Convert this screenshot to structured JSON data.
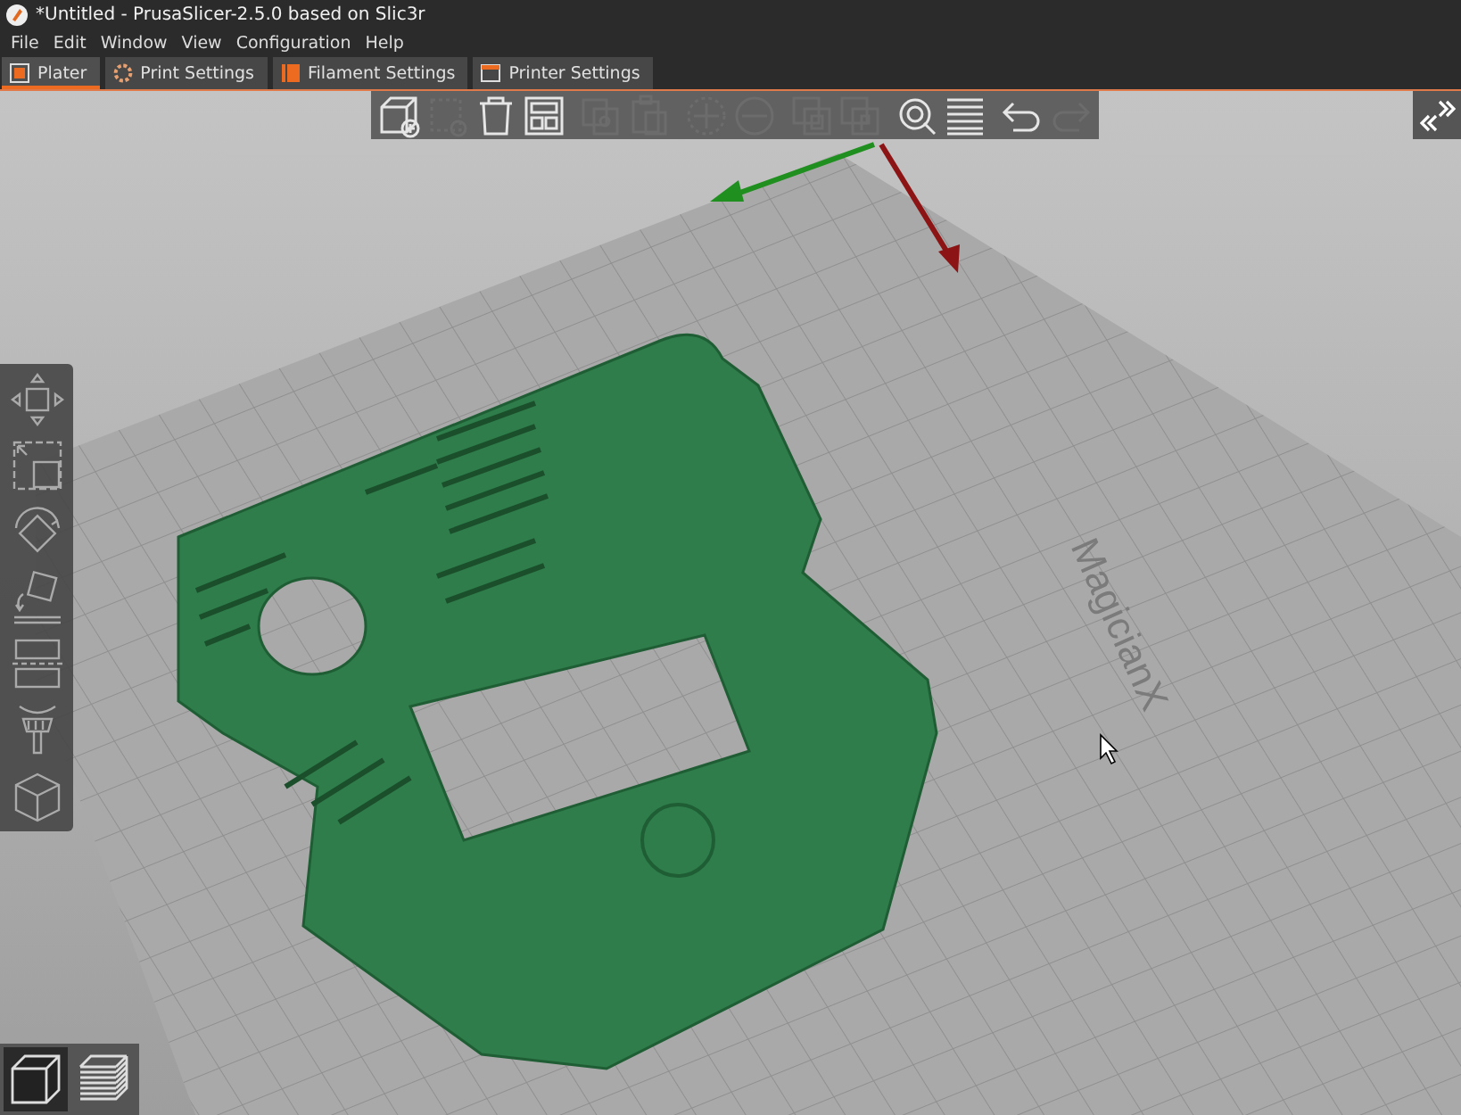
{
  "window": {
    "title": "*Untitled - PrusaSlicer-2.5.0 based on Slic3r"
  },
  "menu": [
    "File",
    "Edit",
    "Window",
    "View",
    "Configuration",
    "Help"
  ],
  "tabs": [
    {
      "label": "Plater",
      "kind": "plater",
      "selected": true
    },
    {
      "label": "Print Settings",
      "kind": "print",
      "selected": false
    },
    {
      "label": "Filament Settings",
      "kind": "filament",
      "selected": false
    },
    {
      "label": "Printer Settings",
      "kind": "printer",
      "selected": false
    }
  ],
  "toolbar": [
    {
      "kind": "add",
      "disabled": false
    },
    {
      "kind": "delete",
      "disabled": true
    },
    {
      "kind": "delete-all",
      "disabled": false
    },
    {
      "kind": "arrange",
      "disabled": false
    },
    {
      "kind": "sep"
    },
    {
      "kind": "copy",
      "disabled": true
    },
    {
      "kind": "paste",
      "disabled": true
    },
    {
      "kind": "sep"
    },
    {
      "kind": "more",
      "disabled": true
    },
    {
      "kind": "fewer",
      "disabled": true
    },
    {
      "kind": "sep"
    },
    {
      "kind": "split-objects",
      "disabled": true
    },
    {
      "kind": "split-parts",
      "disabled": true
    },
    {
      "kind": "sep"
    },
    {
      "kind": "search",
      "disabled": false
    },
    {
      "kind": "layers",
      "disabled": false
    },
    {
      "kind": "sep"
    },
    {
      "kind": "undo",
      "disabled": false
    },
    {
      "kind": "redo",
      "disabled": true
    }
  ],
  "gizmos": [
    {
      "kind": "move"
    },
    {
      "kind": "scale"
    },
    {
      "kind": "rotate"
    },
    {
      "kind": "place"
    },
    {
      "kind": "cut"
    },
    {
      "kind": "paint"
    },
    {
      "kind": "cube"
    }
  ],
  "view_buttons": [
    {
      "kind": "solid",
      "selected": true
    },
    {
      "kind": "preview",
      "selected": false
    }
  ],
  "bed": {
    "label": "MagicianX"
  }
}
